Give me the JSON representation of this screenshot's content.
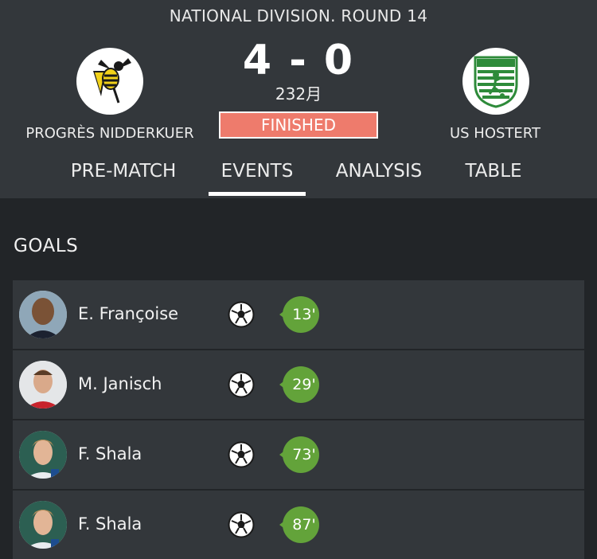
{
  "match": {
    "competition_round": "NATIONAL DIVISION. ROUND 14",
    "score": "4 - 0",
    "score_sub": "232月",
    "status": "FINISHED",
    "home_team": {
      "name": "PROGRÈS NIDDERKUER",
      "logo_icon": "wasp-crest-icon"
    },
    "away_team": {
      "name": "US HOSTERT",
      "logo_icon": "footballer-crest-icon"
    }
  },
  "tabs": [
    {
      "label": "PRE-MATCH"
    },
    {
      "label": "EVENTS",
      "active": true
    },
    {
      "label": "ANALYSIS"
    },
    {
      "label": "TABLE"
    }
  ],
  "goals": {
    "title": "GOALS",
    "items": [
      {
        "player": "E. Françoise",
        "minute": "13'",
        "icon": "soccer-ball-icon"
      },
      {
        "player": "M. Janisch",
        "minute": "29'",
        "icon": "soccer-ball-icon"
      },
      {
        "player": "F. Shala",
        "minute": "73'",
        "icon": "soccer-ball-icon"
      },
      {
        "player": "F. Shala",
        "minute": "87'",
        "icon": "soccer-ball-icon"
      }
    ]
  },
  "colors": {
    "header_bg": "#33373b",
    "page_bg": "#222528",
    "status_badge": "#ee7b6c",
    "minute_bubble": "#63a33a"
  }
}
